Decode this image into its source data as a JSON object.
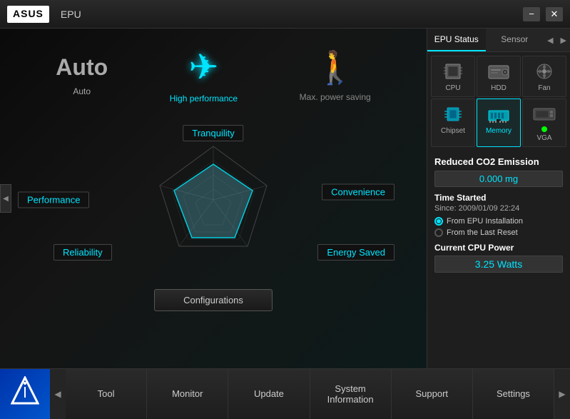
{
  "titlebar": {
    "logo": "ASUS",
    "app_name": "EPU",
    "minimize_label": "−",
    "close_label": "✕"
  },
  "mode_selector": {
    "auto_label": "Auto",
    "auto_text": "Auto",
    "high_perf_label": "High performance",
    "max_saving_label": "Max. power saving"
  },
  "chart_labels": {
    "top": "Tranquility",
    "left": "Performance",
    "right": "Convenience",
    "bottom_left": "Reliability",
    "bottom_right": "Energy Saved"
  },
  "config_btn": "Configurations",
  "right_panel": {
    "tab_epu_status": "EPU Status",
    "tab_sensor": "Sensor",
    "nav_left": "◀",
    "nav_right": "▶",
    "icons": [
      {
        "label": "CPU",
        "active": false
      },
      {
        "label": "HDD",
        "active": false
      },
      {
        "label": "Fan",
        "active": false
      },
      {
        "label": "Chipset",
        "active": false
      },
      {
        "label": "Memory",
        "active": true
      },
      {
        "label": "VGA",
        "active": false,
        "dot": true
      }
    ],
    "reduced_co2_title": "Reduced CO2 Emission",
    "reduced_co2_value": "0.000 mg",
    "time_started_title": "Time Started",
    "time_since": "Since: 2009/01/09 22:24",
    "radio_from_epu": "From EPU Installation",
    "radio_from_reset": "From the Last Reset",
    "cpu_power_title": "Current CPU Power",
    "cpu_power_value": "3.25 Watts"
  },
  "bottom_nav": {
    "nav_prev": "◀",
    "nav_next": "▶",
    "tabs": [
      {
        "label": "Tool"
      },
      {
        "label": "Monitor"
      },
      {
        "label": "Update"
      },
      {
        "label": "System\nInformation"
      },
      {
        "label": "Support"
      },
      {
        "label": "Settings"
      }
    ]
  }
}
